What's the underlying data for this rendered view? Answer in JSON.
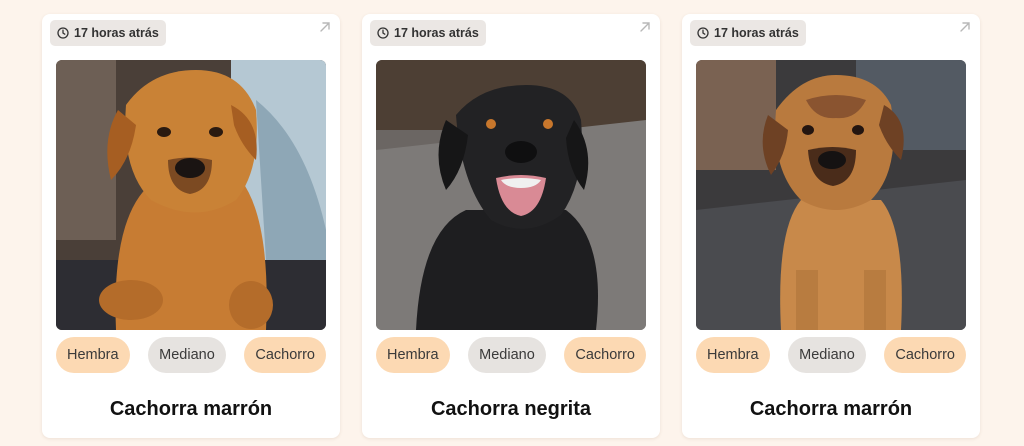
{
  "colors": {
    "page_background": "#fdf4ec",
    "card_background": "#ffffff",
    "tag_warm": "#fcd9b3",
    "tag_gray": "#e6e3e0"
  },
  "cards": [
    {
      "time": "17 horas atrás",
      "tags": [
        "Hembra",
        "Mediano",
        "Cachorro"
      ],
      "name": "Cachorra marrón"
    },
    {
      "time": "17 horas atrás",
      "tags": [
        "Hembra",
        "Mediano",
        "Cachorro"
      ],
      "name": "Cachorra negrita"
    },
    {
      "time": "17 horas atrás",
      "tags": [
        "Hembra",
        "Mediano",
        "Cachorro"
      ],
      "name": "Cachorra marrón"
    }
  ]
}
